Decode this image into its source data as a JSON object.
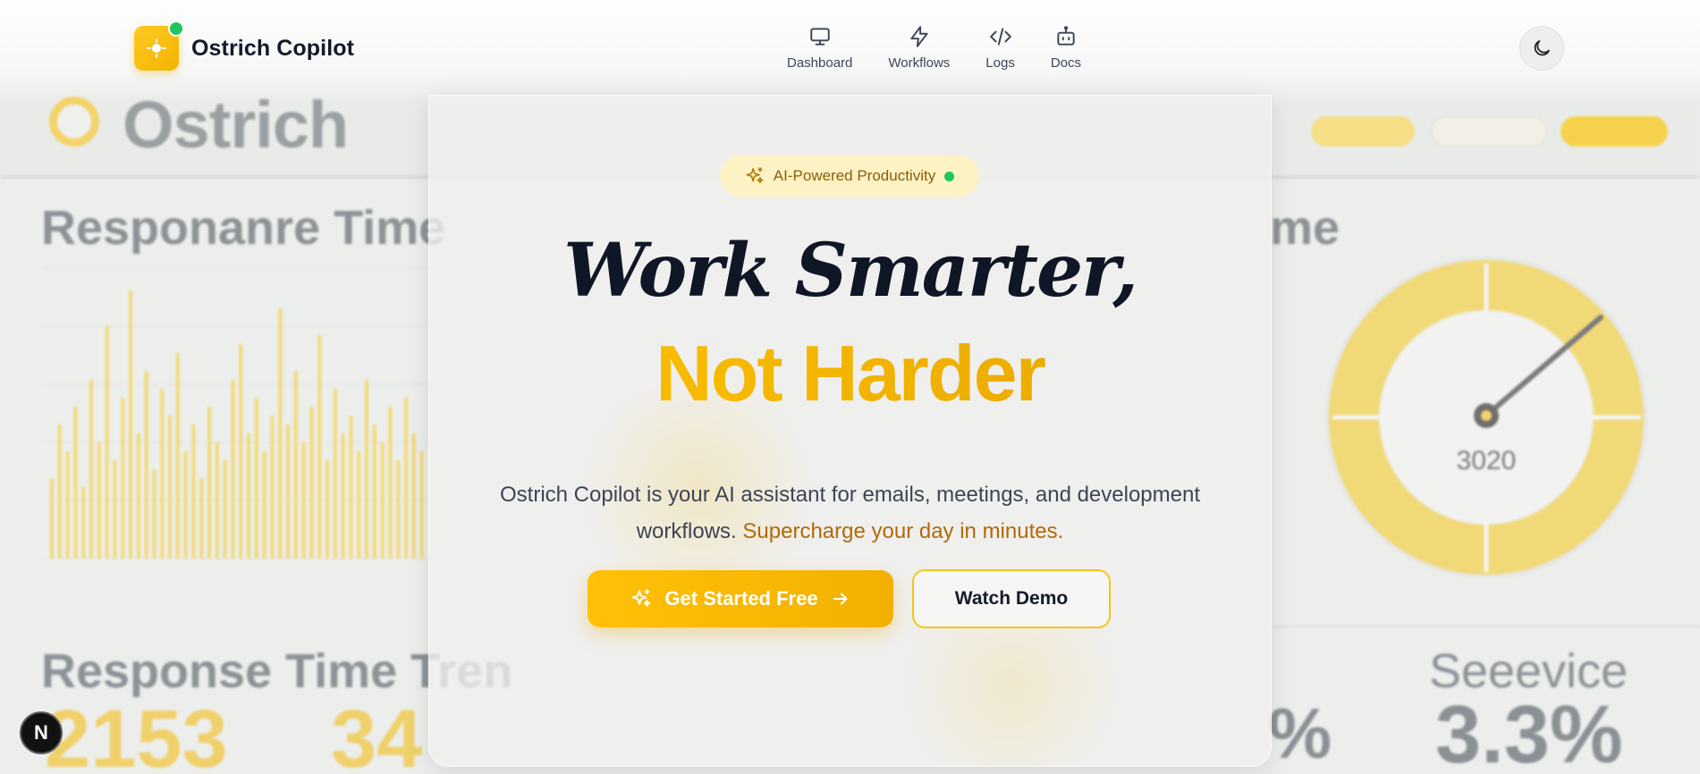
{
  "brand": {
    "name": "Ostrich Copilot"
  },
  "nav": [
    {
      "label": "Dashboard",
      "icon": "monitor-icon"
    },
    {
      "label": "Workflows",
      "icon": "lightning-icon"
    },
    {
      "label": "Logs",
      "icon": "code-icon"
    },
    {
      "label": "Docs",
      "icon": "robot-icon"
    }
  ],
  "theme_toggle": {
    "icon": "moon-icon"
  },
  "hero": {
    "badge": "AI-Powered Productivity",
    "title_line1": "Work Smarter,",
    "title_line2": "Not Harder",
    "subtitle": "Ostrich Copilot is your AI assistant for emails, meetings, and development workflows.",
    "subtitle_accent": "Supercharge your day in minutes.",
    "primary_button": "Get Started Free",
    "secondary_button": "Watch Demo"
  },
  "background": {
    "brand": "Ostrich",
    "panel_title_left": "Responanre Time",
    "panel_title_right": "me",
    "panel_title_bottom": "Response Time Tren",
    "panel_title_bottom_right": "Seeevice",
    "gauge_value": "3020",
    "stat_left_1": "2153",
    "stat_left_2": "34",
    "stat_mid": "%",
    "stat_right": "3.3%"
  },
  "dev_indicator": {
    "label": "N"
  },
  "colors": {
    "accent": "#F5B800",
    "accent_dark": "#B16A08",
    "text": "#0F1626",
    "online": "#1FC55E"
  }
}
